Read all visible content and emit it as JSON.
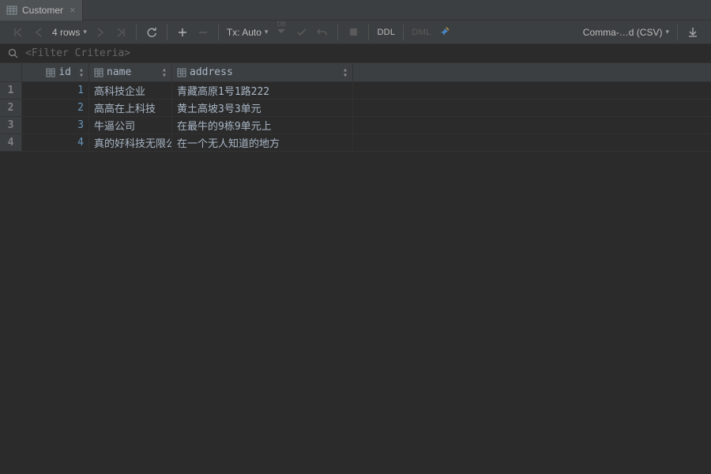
{
  "tab": {
    "label": "Customer"
  },
  "toolbar": {
    "rows_label": "4 rows",
    "tx_label": "Tx: Auto",
    "ddl_label": "DDL",
    "dml_label": "DML",
    "export_label": "Comma-…d (CSV)"
  },
  "filter": {
    "placeholder": "<Filter Criteria>"
  },
  "columns": {
    "id": "id",
    "name": "name",
    "address": "address"
  },
  "rows": [
    {
      "n": "1",
      "id": "1",
      "name": "高科技企业",
      "address": "青藏高原1号1路222"
    },
    {
      "n": "2",
      "id": "2",
      "name": "高高在上科技",
      "address": "黄土高坡3号3单元"
    },
    {
      "n": "3",
      "id": "3",
      "name": "牛逼公司",
      "address": "在最牛的9栋9单元上"
    },
    {
      "n": "4",
      "id": "4",
      "name": "真的好科技无限公司",
      "address": "在一个无人知道的地方"
    }
  ]
}
